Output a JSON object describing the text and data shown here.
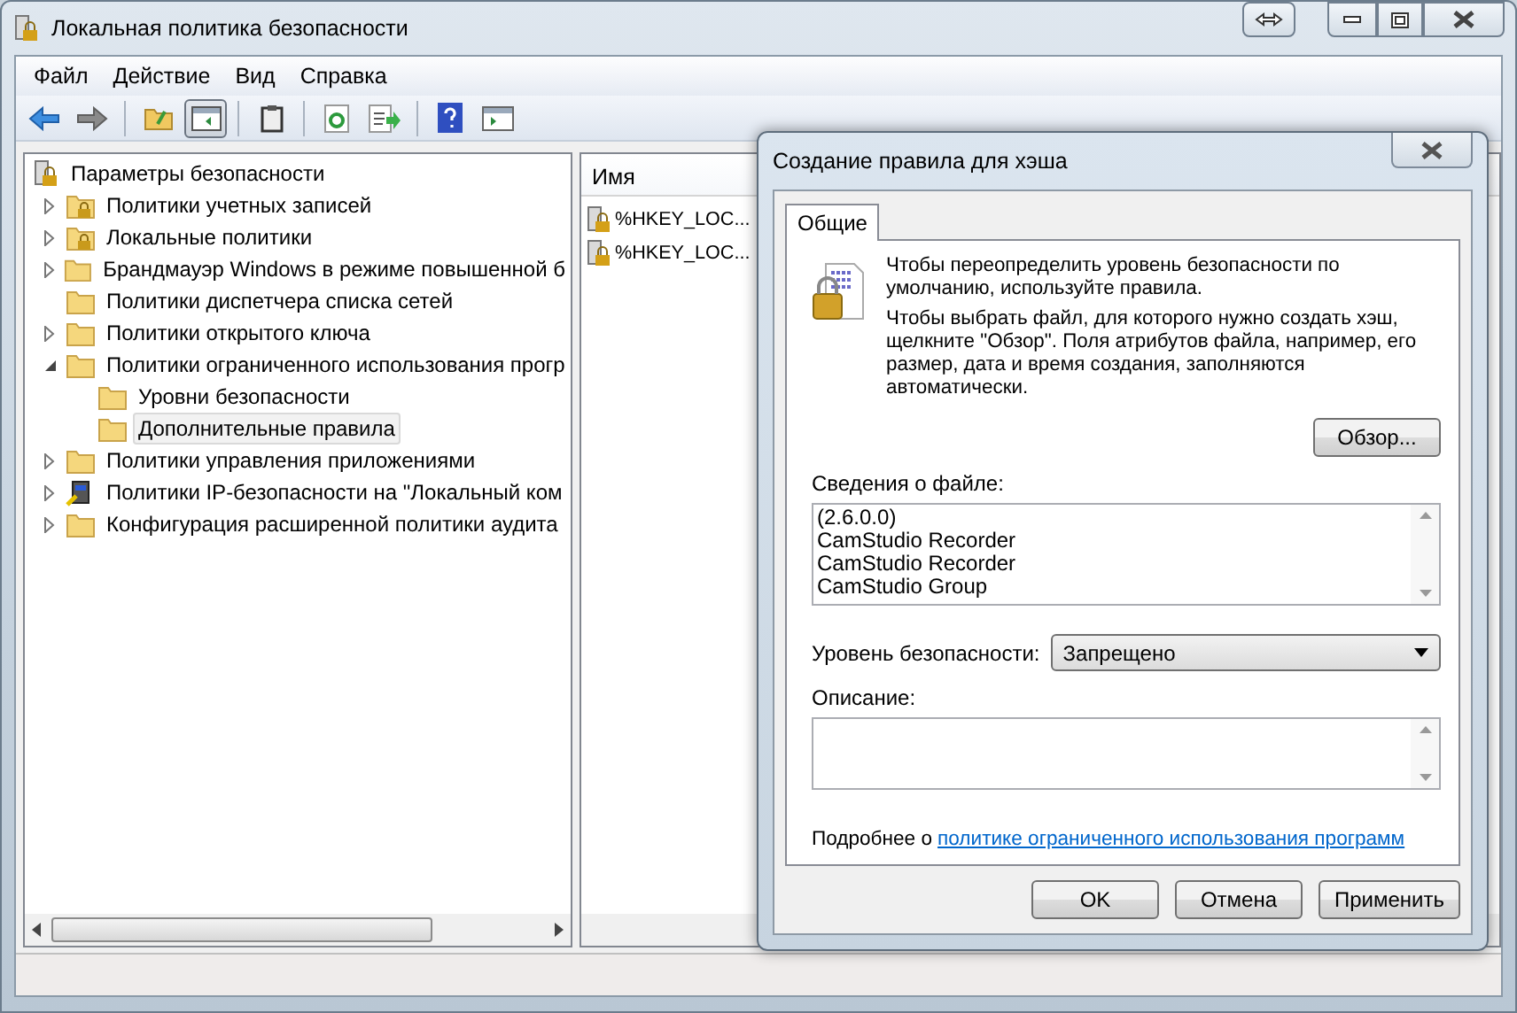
{
  "window": {
    "title": "Локальная политика безопасности"
  },
  "menu": [
    {
      "label": "Файл"
    },
    {
      "label": "Действие"
    },
    {
      "label": "Вид"
    },
    {
      "label": "Справка"
    }
  ],
  "toolbar": [
    {
      "kind": "back"
    },
    {
      "kind": "forward"
    },
    {
      "kind": "sep"
    },
    {
      "kind": "up"
    },
    {
      "kind": "tree",
      "selected": true
    },
    {
      "kind": "sep"
    },
    {
      "kind": "clipboard"
    },
    {
      "kind": "sep"
    },
    {
      "kind": "refresh"
    },
    {
      "kind": "export"
    },
    {
      "kind": "sep"
    },
    {
      "kind": "help"
    },
    {
      "kind": "panel"
    }
  ],
  "tree": {
    "label": "Параметры безопасности",
    "children": [
      {
        "label": "Политики учетных записей",
        "kind": "lock-folder",
        "expanded": false,
        "selected": false
      },
      {
        "label": "Локальные политики",
        "kind": "lock-folder",
        "expanded": false,
        "selected": false
      },
      {
        "label": "Брандмауэр Windows в режиме повышенной б",
        "kind": "folder",
        "expanded": false,
        "selected": false
      },
      {
        "label": "Политики диспетчера списка сетей",
        "kind": "folder",
        "selected": false
      },
      {
        "label": "Политики открытого ключа",
        "kind": "folder",
        "expanded": false,
        "selected": false
      },
      {
        "label": "Политики ограниченного использования прогр",
        "kind": "folder",
        "expanded": true,
        "selected": false,
        "children": [
          {
            "label": "Уровни безопасности",
            "kind": "folder",
            "selected": false
          },
          {
            "label": "Дополнительные правила",
            "kind": "folder",
            "selected": true
          }
        ]
      },
      {
        "label": "Политики управления приложениями",
        "kind": "folder",
        "expanded": false,
        "selected": false
      },
      {
        "label": "Политики IP-безопасности на \"Локальный ком",
        "kind": "computer",
        "expanded": false,
        "selected": false
      },
      {
        "label": "Конфигурация расширенной политики аудита",
        "kind": "folder",
        "expanded": false,
        "selected": false
      }
    ]
  },
  "list": {
    "column": "Имя",
    "rows": [
      {
        "name": "%HKEY_LOC..."
      },
      {
        "name": "%HKEY_LOC..."
      }
    ]
  },
  "dialog": {
    "title": "Создание правила для хэша",
    "tabs": [
      {
        "label": "Общие",
        "selected": true
      }
    ],
    "intro": [
      "Чтобы переопределить уровень безопасности по умолчанию, используйте правила.",
      "Чтобы выбрать файл, для которого нужно создать хэш, щелкните \"Обзор\". Поля атрибутов файла, например, его размер, дата и время создания, заполняются автоматически."
    ],
    "browse_button": "Обзор...",
    "file_info_label": "Сведения о файле:",
    "file_info": [
      "(2.6.0.0)",
      "CamStudio Recorder",
      "CamStudio Recorder",
      "CamStudio Group"
    ],
    "level_label": "Уровень безопасности:",
    "level_value": "Запрещено",
    "description_label": "Описание:",
    "more_text": "Подробнее о",
    "more_link": "политике ограниченного использования программ",
    "buttons": [
      "OK",
      "Отмена",
      "Применить"
    ]
  }
}
